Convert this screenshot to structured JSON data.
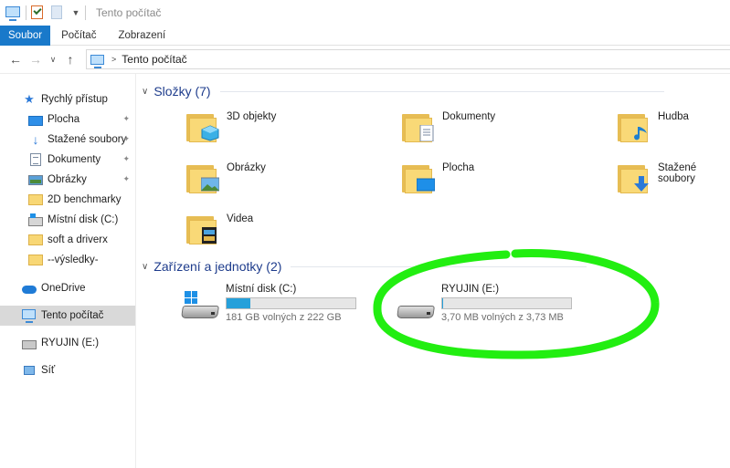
{
  "window": {
    "title": "Tento počítač"
  },
  "ribbon": {
    "tabs": [
      "Soubor",
      "Počítač",
      "Zobrazení"
    ]
  },
  "address": {
    "path": "Tento počítač"
  },
  "sidebar": {
    "items": [
      {
        "label": "Rychlý přístup",
        "icon": "quick-access-star-icon"
      },
      {
        "label": "Plocha",
        "icon": "desktop-icon",
        "pinned": true
      },
      {
        "label": "Stažené soubory",
        "icon": "downloads-icon",
        "pinned": true
      },
      {
        "label": "Dokumenty",
        "icon": "documents-icon",
        "pinned": true
      },
      {
        "label": "Obrázky",
        "icon": "pictures-icon",
        "pinned": true
      },
      {
        "label": "2D benchmarky",
        "icon": "folder-icon"
      },
      {
        "label": "Místní disk (C:)",
        "icon": "local-disk-icon"
      },
      {
        "label": "soft a driverx",
        "icon": "folder-icon"
      },
      {
        "label": "--výsledky-",
        "icon": "folder-icon"
      },
      {
        "label": "OneDrive",
        "icon": "onedrive-cloud-icon"
      },
      {
        "label": "Tento počítač",
        "icon": "this-pc-icon",
        "selected": true
      },
      {
        "label": "RYUJIN (E:)",
        "icon": "usb-drive-icon"
      },
      {
        "label": "Síť",
        "icon": "network-icon"
      }
    ]
  },
  "folders": {
    "heading": "Složky (7)",
    "items": [
      {
        "label": "3D objekty",
        "icon": "3d-objects-folder-icon"
      },
      {
        "label": "Dokumenty",
        "icon": "documents-folder-icon"
      },
      {
        "label": "Hudba",
        "icon": "music-folder-icon"
      },
      {
        "label": "Obrázky",
        "icon": "pictures-folder-icon"
      },
      {
        "label": "Plocha",
        "icon": "desktop-folder-icon"
      },
      {
        "label": "Stažené soubory",
        "icon": "downloads-folder-icon"
      },
      {
        "label": "Videa",
        "icon": "videos-folder-icon"
      }
    ]
  },
  "devices": {
    "heading": "Zařízení a jednotky (2)",
    "items": [
      {
        "name": "Místní disk (C:)",
        "free": "181 GB volných z 222 GB",
        "used_fraction": 0.185,
        "icon": "windows-drive-icon"
      },
      {
        "name": "RYUJIN (E:)",
        "free": "3,70 MB volných z 3,73 MB",
        "used_fraction": 0.01,
        "icon": "usb-drive-icon"
      }
    ]
  },
  "colors": {
    "accent": "#1979ca",
    "bar_fill": "#26a0da",
    "highlight": "#22ee11",
    "group_heading": "#1e3c8c"
  }
}
